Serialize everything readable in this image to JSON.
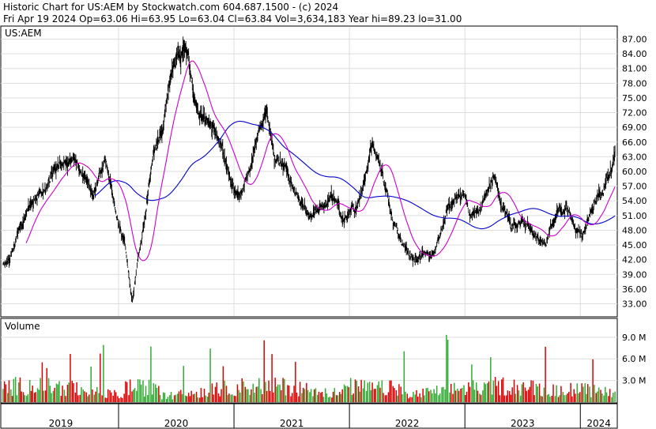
{
  "header": {
    "line1": "Historic Chart for US:AEM by Stockwatch.com 604.687.1500 - (c) 2024",
    "line2": "Fri Apr 19 2024   Op=63.06   Hi=63.95   Lo=63.04   Cl=63.84   Vol=3,634,183   Year hi=89.23   lo=31.00"
  },
  "chart_data": [
    {
      "type": "line",
      "label": "US:AEM",
      "series": [
        {
          "role": "daily high-low bars",
          "color": "#000000"
        },
        {
          "role": "short moving average",
          "color": "#cc00cc"
        },
        {
          "role": "long moving average",
          "color": "#0000cc"
        }
      ],
      "price_path": {
        "x": [
          2019.0,
          2019.05,
          2019.12,
          2019.22,
          2019.3,
          2019.45,
          2019.58,
          2019.7,
          2019.78,
          2019.88,
          2019.98,
          2020.05,
          2020.12,
          2020.16,
          2020.2,
          2020.25,
          2020.3,
          2020.38,
          2020.45,
          2020.52,
          2020.6,
          2020.65,
          2020.72,
          2020.8,
          2020.9,
          2021.0,
          2021.05,
          2021.1,
          2021.2,
          2021.28,
          2021.35,
          2021.45,
          2021.55,
          2021.65,
          2021.75,
          2021.85,
          2021.95,
          2022.05,
          2022.12,
          2022.2,
          2022.25,
          2022.35,
          2022.45,
          2022.55,
          2022.65,
          2022.72,
          2022.8,
          2022.9,
          2023.0,
          2023.05,
          2023.12,
          2023.2,
          2023.25,
          2023.32,
          2023.4,
          2023.5,
          2023.6,
          2023.7,
          2023.8,
          2023.88,
          2023.95,
          2024.02,
          2024.1,
          2024.2,
          2024.25,
          2024.3
        ],
        "close": [
          41.0,
          41.5,
          47.0,
          52.5,
          55.0,
          60.0,
          62.0,
          59.0,
          56.0,
          62.0,
          51.0,
          46.0,
          34.0,
          41.0,
          46.0,
          54.0,
          63.0,
          68.0,
          80.0,
          84.0,
          83.0,
          75.0,
          71.0,
          70.0,
          64.0,
          56.0,
          55.0,
          58.0,
          67.0,
          72.0,
          63.0,
          60.0,
          55.0,
          50.0,
          52.0,
          55.0,
          50.0,
          52.0,
          58.0,
          66.0,
          63.0,
          53.0,
          46.0,
          42.0,
          43.0,
          43.0,
          49.0,
          54.0,
          55.0,
          51.0,
          52.0,
          56.0,
          59.0,
          53.0,
          49.0,
          50.0,
          47.0,
          45.0,
          52.0,
          53.0,
          49.0,
          47.0,
          52.0,
          57.0,
          60.0,
          63.8
        ]
      },
      "y_ticks": [
        "87.00",
        "84.00",
        "81.00",
        "78.00",
        "75.00",
        "72.00",
        "69.00",
        "66.00",
        "63.00",
        "60.00",
        "57.00",
        "54.00",
        "51.00",
        "48.00",
        "45.00",
        "42.00",
        "39.00",
        "36.00",
        "33.00"
      ],
      "ylim": [
        30.5,
        89.5
      ],
      "xlim": [
        2018.98,
        2024.32
      ]
    },
    {
      "type": "bar",
      "label": "Volume",
      "up_color": "#33aa33",
      "down_color": "#dd0000",
      "y_ticks": [
        "9.0 M",
        "6.0 M",
        "3.0 M"
      ],
      "ylim": [
        0,
        11.5
      ]
    }
  ],
  "x_axis": {
    "labels": [
      "2019",
      "2020",
      "2021",
      "2022",
      "2023",
      "2024"
    ]
  }
}
